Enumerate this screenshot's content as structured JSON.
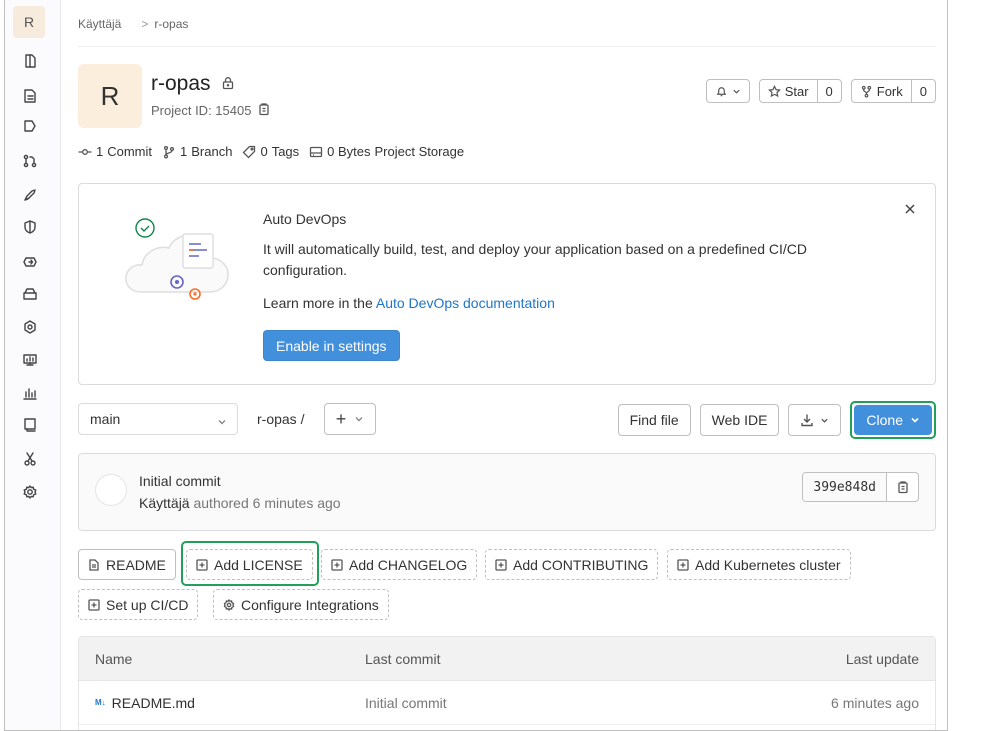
{
  "sidebar": {
    "avatar_letter": "R",
    "icons": [
      "project-overview-icon",
      "repository-icon",
      "issues-icon",
      "merge-requests-icon",
      "cicd-icon",
      "security-icon",
      "deployments-icon",
      "packages-icon",
      "infrastructure-icon",
      "monitor-icon",
      "analytics-icon",
      "wiki-icon",
      "snippets-icon",
      "settings-icon"
    ]
  },
  "breadcrumb": {
    "parent": "Käyttäjä",
    "separator": ">",
    "current": "r-opas"
  },
  "project": {
    "avatar_letter": "R",
    "name": "r-opas",
    "id_label": "Project ID: 15405"
  },
  "actions": {
    "star_label": "Star",
    "star_count": "0",
    "fork_label": "Fork",
    "fork_count": "0"
  },
  "stats": {
    "commits": "1",
    "commits_label": "Commit",
    "branches": "1",
    "branches_label": "Branch",
    "tags": "0",
    "tags_label": "Tags",
    "size": "0 Bytes",
    "size_label": "Project Storage"
  },
  "devops": {
    "title": "Auto DevOps",
    "text": "It will automatically build, test, and deploy your application based on a predefined CI/CD configuration.",
    "learn_prefix": "Learn more in the",
    "learn_link": "Auto DevOps  documentation",
    "button": "Enable in settings"
  },
  "toolbar": {
    "branch": "main",
    "path": "r-opas  /",
    "find_file": "Find file",
    "web_ide": "Web IDE",
    "clone": "Clone"
  },
  "commit": {
    "title": "Initial commit",
    "author": "Käyttäjä",
    "meta": "authored 6 minutes ago",
    "sha": "399e848d"
  },
  "quick_buttons": {
    "readme": "README",
    "license": "Add LICENSE",
    "changelog": "Add CHANGELOG",
    "contributing": "Add CONTRIBUTING",
    "kubernetes": "Add Kubernetes cluster",
    "cicd": "Set up CI/CD",
    "integrations": "Configure Integrations"
  },
  "files": {
    "headers": {
      "name": "Name",
      "last_commit": "Last commit",
      "last_update": "Last update"
    },
    "rows": [
      {
        "name": "README.md",
        "commit": "Initial commit",
        "updated": "6 minutes ago"
      }
    ]
  },
  "colors": {
    "accent": "#428fdc",
    "highlight": "#22a05b",
    "link": "#1f75cb"
  }
}
